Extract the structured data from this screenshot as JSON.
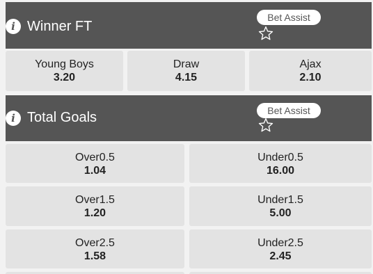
{
  "markets": {
    "winner": {
      "title": "Winner FT",
      "bet_assist_label": "Bet Assist",
      "selections": [
        {
          "name": "Young Boys",
          "odds": "3.20"
        },
        {
          "name": "Draw",
          "odds": "4.15"
        },
        {
          "name": "Ajax",
          "odds": "2.10"
        }
      ]
    },
    "total_goals": {
      "title": "Total Goals",
      "bet_assist_label": "Bet Assist",
      "rows": [
        {
          "over": {
            "name": "Over0.5",
            "odds": "1.04"
          },
          "under": {
            "name": "Under0.5",
            "odds": "16.00"
          }
        },
        {
          "over": {
            "name": "Over1.5",
            "odds": "1.20"
          },
          "under": {
            "name": "Under1.5",
            "odds": "5.00"
          }
        },
        {
          "over": {
            "name": "Over2.5",
            "odds": "1.58"
          },
          "under": {
            "name": "Under2.5",
            "odds": "2.45"
          }
        }
      ]
    }
  },
  "icons": {
    "info": "info-icon",
    "favourite": "star-icon"
  },
  "colors": {
    "header_bg": "#555555",
    "cell_bg": "#e3e3e3",
    "page_bg": "#f2f2f2"
  }
}
